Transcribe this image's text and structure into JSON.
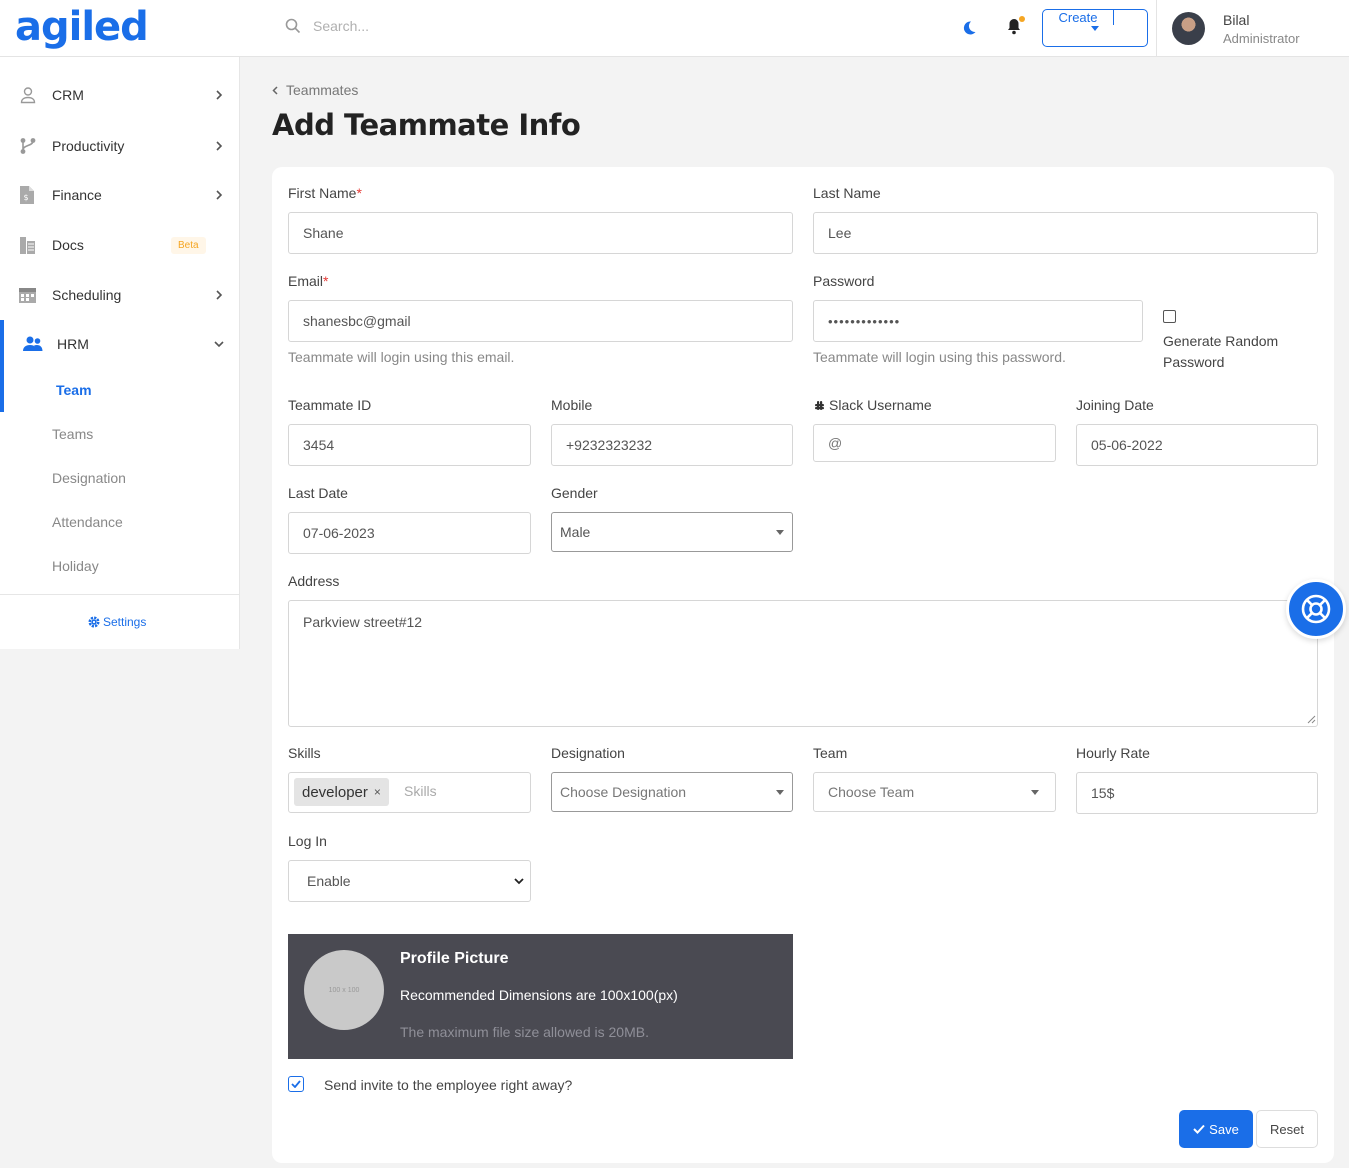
{
  "header": {
    "logo": "agiled",
    "search_placeholder": "Search...",
    "create_label": "Create",
    "user_name": "Bilal",
    "user_role": "Administrator"
  },
  "sidebar": {
    "items": [
      {
        "label": "CRM"
      },
      {
        "label": "Productivity"
      },
      {
        "label": "Finance"
      },
      {
        "label": "Docs",
        "badge": "Beta"
      },
      {
        "label": "Scheduling"
      },
      {
        "label": "HRM"
      }
    ],
    "hrm_sub": [
      "Team",
      "Teams",
      "Designation",
      "Attendance",
      "Holiday"
    ],
    "settings": "Settings"
  },
  "page": {
    "breadcrumb": "Teammates",
    "title": "Add Teammate Info"
  },
  "form": {
    "first_name": {
      "label": "First Name",
      "value": "Shane"
    },
    "last_name": {
      "label": "Last Name",
      "value": "Lee"
    },
    "email": {
      "label": "Email",
      "value": "shanesbc@gmail",
      "help": "Teammate will login using this email."
    },
    "password": {
      "label": "Password",
      "value": "•••••••••••••",
      "help": "Teammate will login using this password."
    },
    "generate_random": "Generate Random Password",
    "teammate_id": {
      "label": "Teammate ID",
      "value": "3454"
    },
    "mobile": {
      "label": "Mobile",
      "value": "+9232323232"
    },
    "slack": {
      "label": "Slack Username",
      "placeholder": "@"
    },
    "joining_date": {
      "label": "Joining Date",
      "value": "05-06-2022"
    },
    "last_date": {
      "label": "Last Date",
      "value": "07-06-2023"
    },
    "gender": {
      "label": "Gender",
      "value": "Male"
    },
    "address": {
      "label": "Address",
      "value": "Parkview street#12"
    },
    "skills": {
      "label": "Skills",
      "chip": "developer",
      "placeholder": "Skills"
    },
    "designation": {
      "label": "Designation",
      "placeholder": "Choose Designation"
    },
    "team": {
      "label": "Team",
      "placeholder": "Choose Team"
    },
    "hourly_rate": {
      "label": "Hourly Rate",
      "value": "15$"
    },
    "log_in": {
      "label": "Log In",
      "value": "Enable"
    },
    "profile": {
      "title": "Profile Picture",
      "placeholder": "100 x 100",
      "dimensions": "Recommended Dimensions are 100x100(px)",
      "max_size": "The maximum file size allowed is 20MB."
    },
    "send_invite": "Send invite to the employee right away?",
    "save": "Save",
    "reset": "Reset"
  },
  "colors": {
    "accent": "#1a6ee8",
    "required": "#e53935",
    "beta": "#f5a623"
  }
}
